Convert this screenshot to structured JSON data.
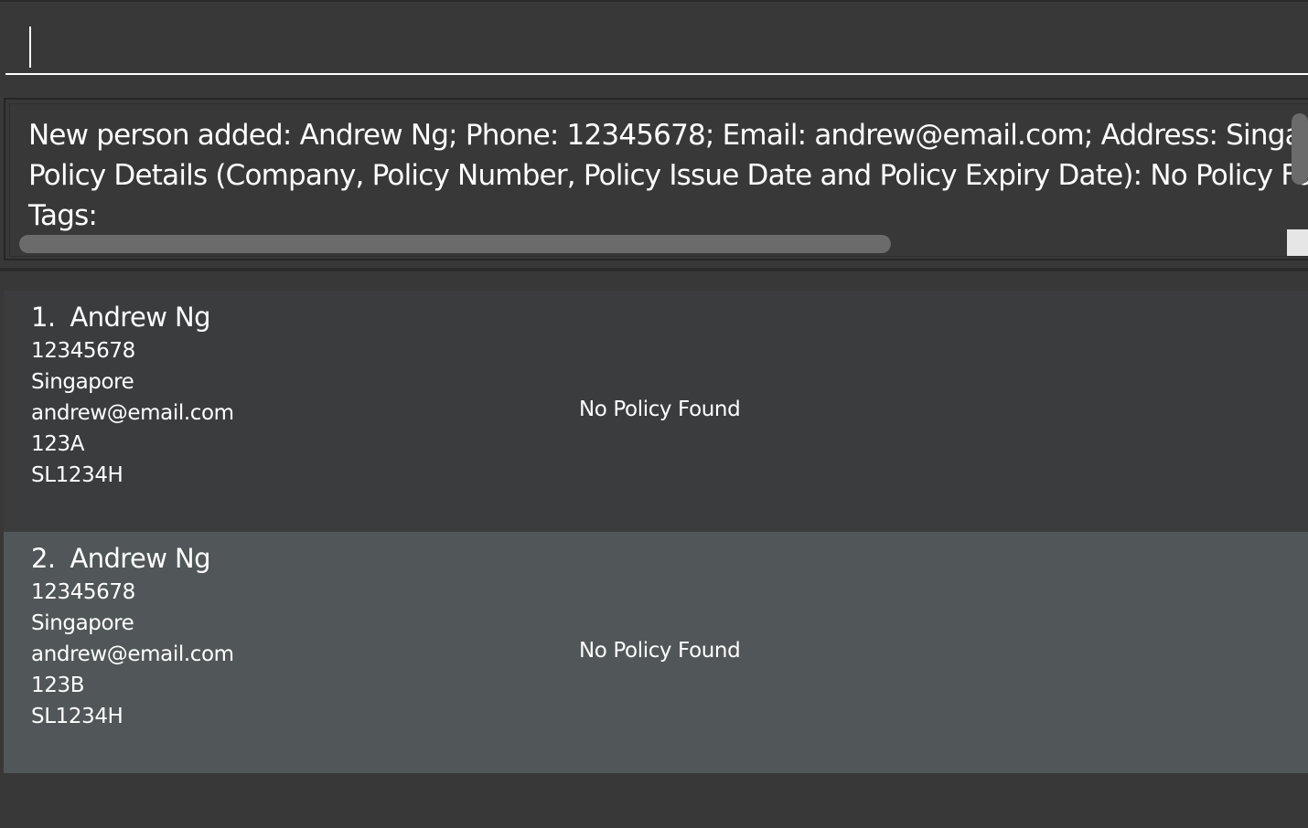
{
  "command_box": {
    "value": "",
    "placeholder": ""
  },
  "result_display": {
    "lines": [
      "New person added: Andrew Ng; Phone: 12345678; Email: andrew@email.com; Address: Singap",
      "Policy Details (Company, Policy Number, Policy Issue Date and Policy Expiry Date): No Policy Fo",
      "Tags:"
    ]
  },
  "person_list": [
    {
      "index": "1.",
      "name": "Andrew Ng",
      "phone": "12345678",
      "address": "Singapore",
      "email": "andrew@email.com",
      "field4": "123A",
      "field5": "SL1234H",
      "policy": "No Policy Found"
    },
    {
      "index": "2.",
      "name": "Andrew Ng",
      "phone": "12345678",
      "address": "Singapore",
      "email": "andrew@email.com",
      "field4": "123B",
      "field5": "SL1234H",
      "policy": "No Policy Found"
    }
  ],
  "colors": {
    "background": "#383838",
    "card_odd": "#3b3c3e",
    "card_even_selected": "#515658",
    "text": "#ffffff",
    "scrollbar_thumb": "#6b6b6b"
  }
}
